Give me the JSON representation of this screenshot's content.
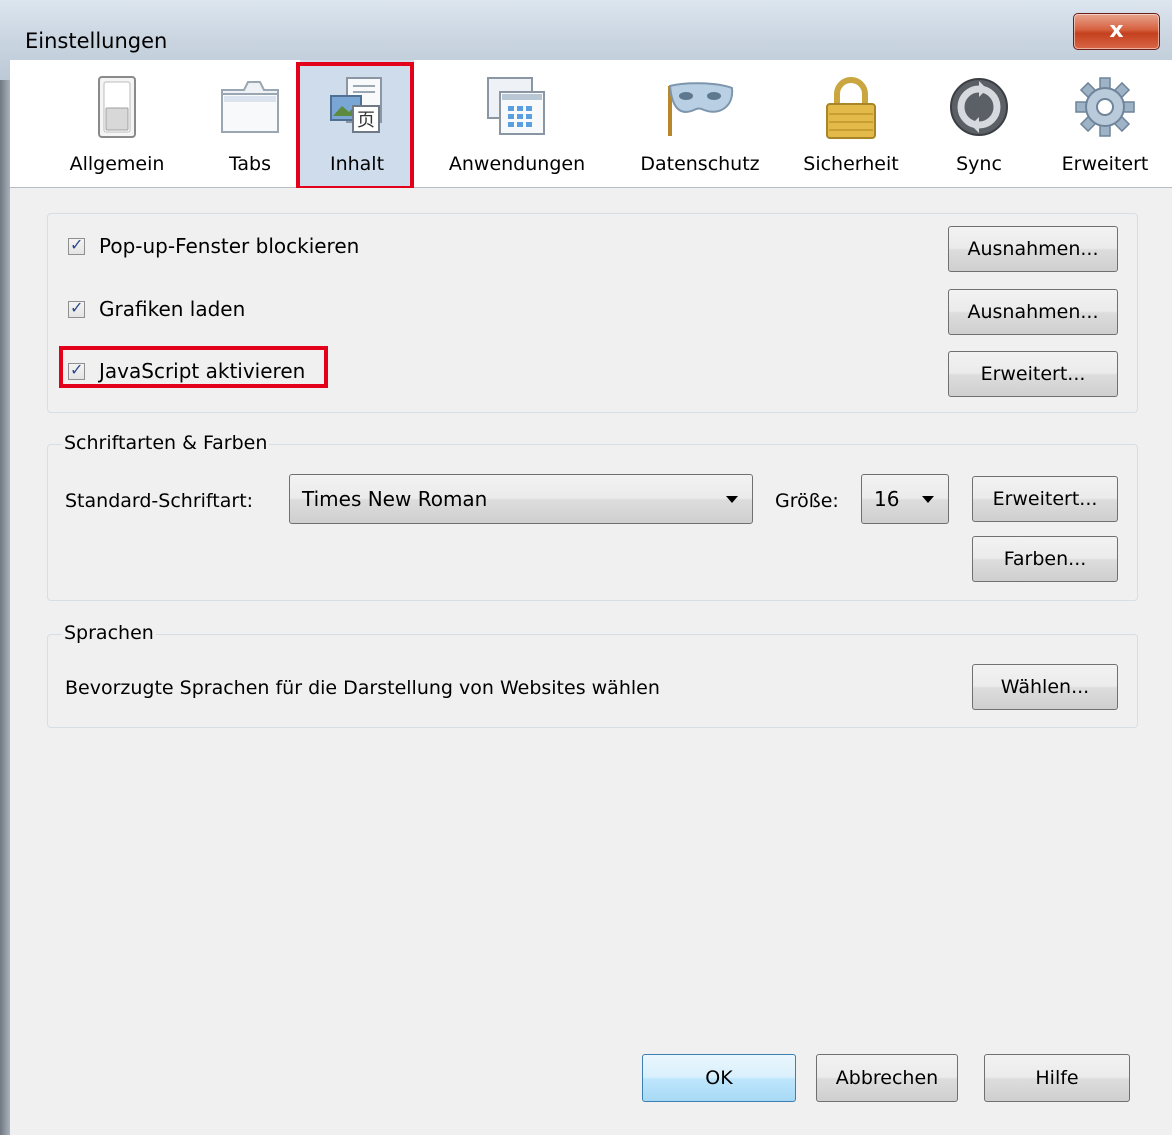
{
  "window": {
    "title": "Einstellungen",
    "close_label": "x"
  },
  "toolbar": {
    "items": [
      {
        "label": "Allgemein",
        "icon": "switch-icon"
      },
      {
        "label": "Tabs",
        "icon": "window-tabs-icon"
      },
      {
        "label": "Inhalt",
        "icon": "page-content-icon",
        "selected": true
      },
      {
        "label": "Anwendungen",
        "icon": "applications-icon"
      },
      {
        "label": "Datenschutz",
        "icon": "mask-icon"
      },
      {
        "label": "Sicherheit",
        "icon": "padlock-icon"
      },
      {
        "label": "Sync",
        "icon": "sync-icon"
      },
      {
        "label": "Erweitert",
        "icon": "gear-icon"
      }
    ]
  },
  "content": {
    "popups": {
      "label": "Pop-up-Fenster blockieren",
      "checked": true,
      "button": "Ausnahmen..."
    },
    "images": {
      "label": "Grafiken laden",
      "checked": true,
      "button": "Ausnahmen..."
    },
    "javascript": {
      "label": "JavaScript aktivieren",
      "checked": true,
      "button": "Erweitert..."
    }
  },
  "fonts": {
    "legend": "Schriftarten & Farben",
    "default_font_label": "Standard-Schriftart:",
    "default_font_value": "Times New Roman",
    "size_label": "Größe:",
    "size_value": "16",
    "advanced_button": "Erweitert...",
    "colors_button": "Farben..."
  },
  "languages": {
    "legend": "Sprachen",
    "description": "Bevorzugte Sprachen für die Darstellung von Websites wählen",
    "choose_button": "Wählen..."
  },
  "footer": {
    "ok": "OK",
    "cancel": "Abbrechen",
    "help": "Hilfe"
  },
  "colors": {
    "highlight_red": "#e3001b",
    "selected_tab_bg": "#cfdcec"
  }
}
